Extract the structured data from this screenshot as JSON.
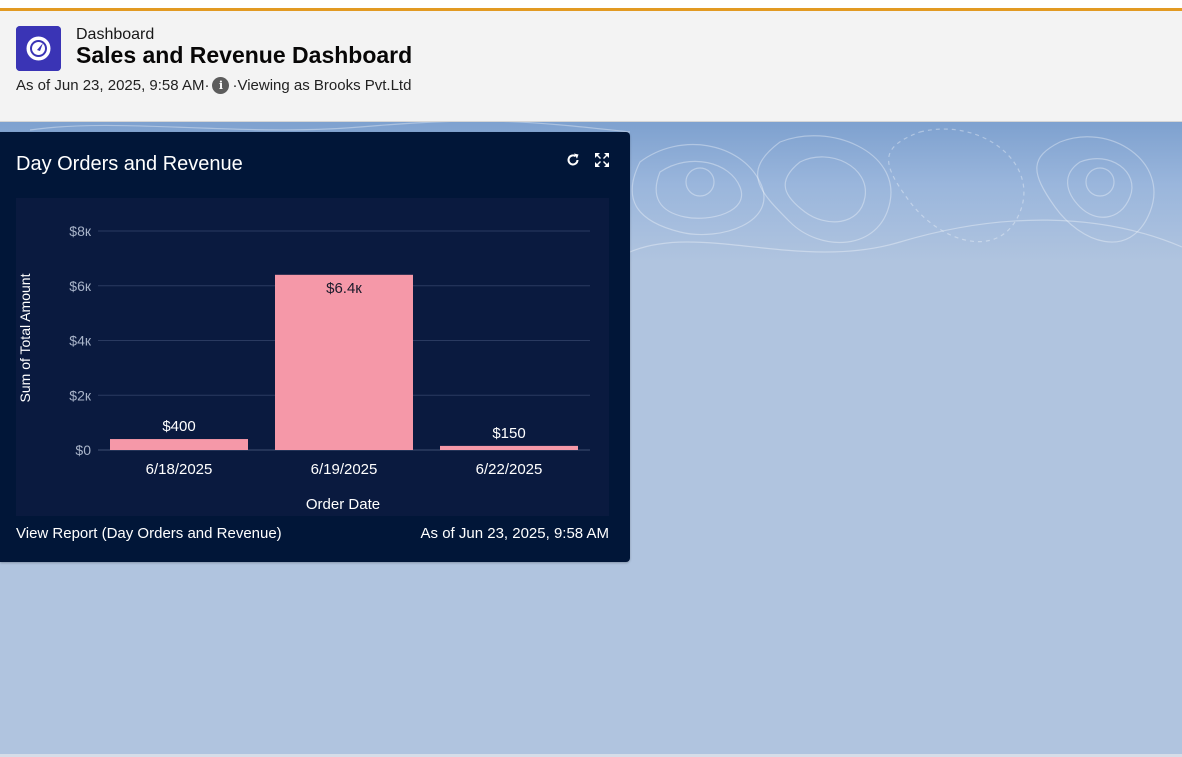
{
  "header": {
    "eyebrow": "Dashboard",
    "title": "Sales and Revenue Dashboard",
    "as_of": "As of Jun 23, 2025, 9:58 AM·",
    "viewing": "·Viewing as Brooks Pvt.Ltd",
    "info_icon_glyph": "i"
  },
  "colors": {
    "accent_topline": "#e29a22",
    "app_icon_bg": "#2c4fbf",
    "card_bg": "#011638",
    "chart_bg": "#0a1a3f",
    "bar": "#f598a8",
    "page_bg": "#b0c4df"
  },
  "card": {
    "title": "Day Orders and Revenue",
    "refresh_icon": "refresh-icon",
    "expand_icon": "expand-icon",
    "footer_link": "View Report (Day Orders and Revenue)",
    "footer_time": "As of Jun 23, 2025, 9:58 AM"
  },
  "chart_data": {
    "type": "bar",
    "categories": [
      "6/18/2025",
      "6/19/2025",
      "6/22/2025"
    ],
    "values": [
      400,
      6400,
      150
    ],
    "data_labels": [
      "$400",
      "$6.4к",
      "$150"
    ],
    "xlabel": "Order Date",
    "ylabel": "Sum of Total Amount",
    "yticks": [
      0,
      2000,
      4000,
      6000,
      8000
    ],
    "ytick_labels": [
      "$0",
      "$2к",
      "$4к",
      "$6к",
      "$8к"
    ],
    "ylim": [
      0,
      8000
    ],
    "grid": true
  }
}
